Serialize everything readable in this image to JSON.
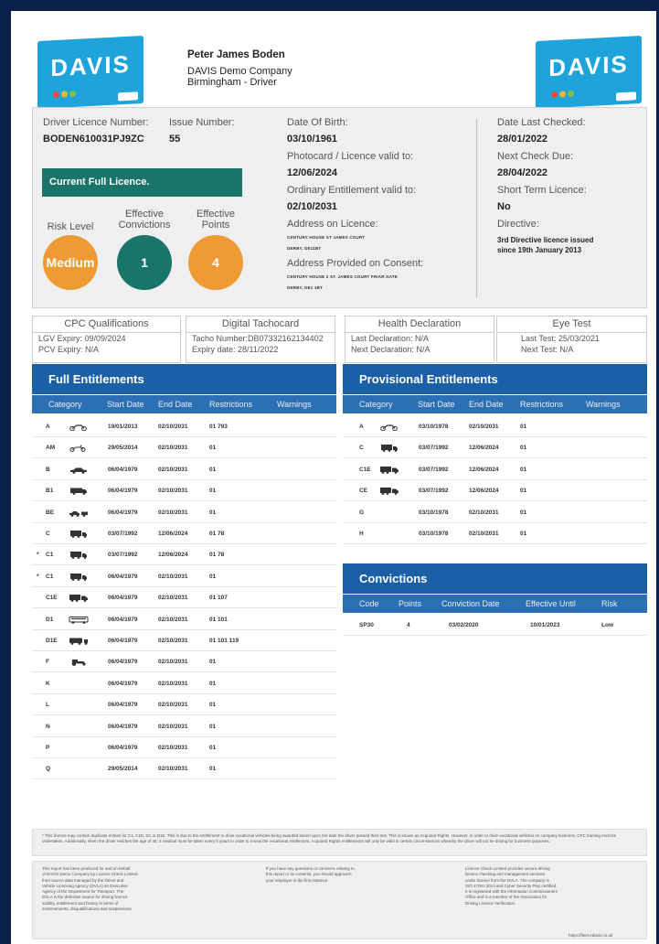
{
  "header": {
    "logo_text": "DAVIS",
    "logo_tagline": "Powered by LICENCECHECK",
    "driver_name": "Peter James Boden",
    "company": "DAVIS Demo Company",
    "location": "Birmingham - Driver"
  },
  "licence": {
    "number_label": "Driver Licence Number:",
    "number": "BODEN610031PJ9ZC",
    "issue_label": "Issue Number:",
    "issue": "55",
    "status": "Current Full Licence.",
    "risk_label": "Risk Level",
    "risk": "Medium",
    "convictions_label": "Effective Convictions",
    "convictions": "1",
    "points_label": "Effective Points",
    "points": "4",
    "dob_label": "Date Of Birth:",
    "dob": "03/10/1961",
    "photocard_label": "Photocard / Licence valid to:",
    "photocard": "12/06/2024",
    "ordinary_label": "Ordinary Entitlement valid to:",
    "ordinary": "02/10/2031",
    "address_label": "Address on Licence:",
    "address_line1": "CENTURY HOUSE ST JAMES COURT",
    "address_line2": "DERBY, DE11BT",
    "consent_label": "Address Provided on Consent:",
    "consent_line1": "CENTURY HOUSE 2 ST. JAMES COURT FRIAR GATE",
    "consent_line2": "DERBY, DE1 1BT",
    "last_checked_label": "Date Last Checked:",
    "last_checked": "28/01/2022",
    "next_check_label": "Next Check Due:",
    "next_check": "28/04/2022",
    "short_term_label": "Short Term Licence:",
    "short_term": "No",
    "directive_label": "Directive:",
    "directive_line1": "3rd Directive licence issued",
    "directive_line2": "since 19th January 2013"
  },
  "boxes": {
    "cpc": {
      "title": "CPC Qualifications",
      "line1": "LGV Expiry:   09/09/2024",
      "line2": "PCV Expiry:   N/A"
    },
    "tacho": {
      "title": "Digital Tachocard",
      "line1": "Tacho Number:DB07332162134402",
      "line2": "Expiry date:      28/11/2022"
    },
    "health": {
      "title": "Health Declaration",
      "line1": "Last Declaration:   N/A",
      "line2": "Next Declaration:   N/A"
    },
    "eye": {
      "title": "Eye Test",
      "line1": "Last Test:   25/03/2021",
      "line2": "Next Test:   N/A"
    }
  },
  "full": {
    "title": "Full Entitlements",
    "headers": [
      "Category",
      "Start Date",
      "End Date",
      "Restrictions",
      "Warnings"
    ],
    "rows": [
      {
        "cat": "A",
        "mark": "",
        "icon": "motorcycle-icon",
        "start": "19/01/2013",
        "end": "02/10/2031",
        "restr": "01 793"
      },
      {
        "cat": "AM",
        "mark": "",
        "icon": "moped-icon",
        "start": "29/05/2014",
        "end": "02/10/2031",
        "restr": "01"
      },
      {
        "cat": "B",
        "mark": "",
        "icon": "car-icon",
        "start": "06/04/1979",
        "end": "02/10/2031",
        "restr": "01"
      },
      {
        "cat": "B1",
        "mark": "",
        "icon": "van-icon",
        "start": "06/04/1979",
        "end": "02/10/2031",
        "restr": "01"
      },
      {
        "cat": "BE",
        "mark": "",
        "icon": "car-trailer-icon",
        "start": "06/04/1979",
        "end": "02/10/2031",
        "restr": "01"
      },
      {
        "cat": "C",
        "mark": "",
        "icon": "truck-icon",
        "start": "03/07/1992",
        "end": "12/06/2024",
        "restr": "01 78"
      },
      {
        "cat": "C1",
        "mark": "*",
        "icon": "truck-icon",
        "start": "03/07/1992",
        "end": "12/06/2024",
        "restr": "01 78"
      },
      {
        "cat": "C1",
        "mark": "*",
        "icon": "truck-icon",
        "start": "06/04/1979",
        "end": "02/10/2031",
        "restr": "01"
      },
      {
        "cat": "C1E",
        "mark": "",
        "icon": "truck-trailer-icon",
        "start": "06/04/1979",
        "end": "02/10/2031",
        "restr": "01 107"
      },
      {
        "cat": "D1",
        "mark": "",
        "icon": "minibus-icon",
        "start": "06/04/1979",
        "end": "02/10/2031",
        "restr": "01 101"
      },
      {
        "cat": "D1E",
        "mark": "",
        "icon": "minibus-trailer-icon",
        "start": "06/04/1979",
        "end": "02/10/2031",
        "restr": "01 101 119"
      },
      {
        "cat": "F",
        "mark": "",
        "icon": "tractor-icon",
        "start": "06/04/1979",
        "end": "02/10/2031",
        "restr": "01"
      },
      {
        "cat": "K",
        "mark": "",
        "icon": "",
        "start": "06/04/1979",
        "end": "02/10/2031",
        "restr": "01"
      },
      {
        "cat": "L",
        "mark": "",
        "icon": "",
        "start": "06/04/1979",
        "end": "02/10/2031",
        "restr": "01"
      },
      {
        "cat": "N",
        "mark": "",
        "icon": "",
        "start": "06/04/1979",
        "end": "02/10/2031",
        "restr": "01"
      },
      {
        "cat": "P",
        "mark": "",
        "icon": "",
        "start": "06/04/1979",
        "end": "02/10/2031",
        "restr": "01"
      },
      {
        "cat": "Q",
        "mark": "",
        "icon": "",
        "start": "29/05/2014",
        "end": "02/10/2031",
        "restr": "01"
      }
    ]
  },
  "provisional": {
    "title": "Provisional Entitlements",
    "headers": [
      "Category",
      "Start Date",
      "End Date",
      "Restrictions",
      "Warnings"
    ],
    "rows": [
      {
        "cat": "A",
        "icon": "motorcycle-icon",
        "start": "03/10/1978",
        "end": "02/10/2031",
        "restr": "01"
      },
      {
        "cat": "C",
        "icon": "truck-icon",
        "start": "03/07/1992",
        "end": "12/06/2024",
        "restr": "01"
      },
      {
        "cat": "C1E",
        "icon": "truck-trailer-icon",
        "start": "03/07/1992",
        "end": "12/06/2024",
        "restr": "01"
      },
      {
        "cat": "CE",
        "icon": "truck-trailer-icon",
        "start": "03/07/1992",
        "end": "12/06/2024",
        "restr": "01"
      },
      {
        "cat": "G",
        "icon": "",
        "start": "03/10/1978",
        "end": "02/10/2031",
        "restr": "01"
      },
      {
        "cat": "H",
        "icon": "",
        "start": "03/10/1978",
        "end": "02/10/2031",
        "restr": "01"
      }
    ]
  },
  "convictions": {
    "title": "Convictions",
    "headers": [
      "Code",
      "Points",
      "Conviction Date",
      "Effective Until",
      "Risk"
    ],
    "rows": [
      {
        "code": "SP30",
        "points": "4",
        "date": "03/02/2020",
        "until": "10/01/2023",
        "risk": "Low"
      }
    ]
  },
  "footer": {
    "note": "* This licence may contain duplicate entries for C1, C1E, D1 or D1E. This is due to the entitlement to drive vocational vehicles being awarded based upon the date the driver passed their test. This is known as Acquired Rights. However, in order to drive vocational vehicles on company business, CPC training must be undertaken. Additionally, when the driver reaches the age of 45, a medical must be taken every 5 years in order to renew the vocational entitlement. Acquired Rights entitlements will only be valid in certain circumstances whereby the driver will not be driving for business purposes.",
    "col1": [
      "This report has been produced for and on behalf",
      "of DAVIS Demo Company by Licence Check Limited.",
      "from source data managed by the Driver and",
      "Vehicle Licensing Agency (DVLA) an Executive",
      "Agency of the Department for Transport. The",
      "DVLA is the definitive source for driving licence",
      "validity, entitlement and history in terms of",
      "endorsements, disqualifications and suspensions."
    ],
    "col2": [
      "If you have any questions or concerns relating to",
      "this report or its contents, you should approach",
      "your employer in the first instance."
    ],
    "col3": [
      "Licence Check Limited provides secure driving",
      "licence checking and management services",
      "under licence from the DVLA. The company is",
      "ISO 27001:2013 and Cyber Security Plus certified.",
      "It is registered with the Information Commissioners",
      "Office and is a member of the Association for",
      "Driving Licence Verification."
    ],
    "url": "https://fleet.edavis.co.uk"
  },
  "colors": {
    "brand_blue": "#1ea3db",
    "section_blue": "#1b5fa6",
    "green": "#19756a",
    "orange": "#ef9a32",
    "navy": "#0b1f4d"
  }
}
